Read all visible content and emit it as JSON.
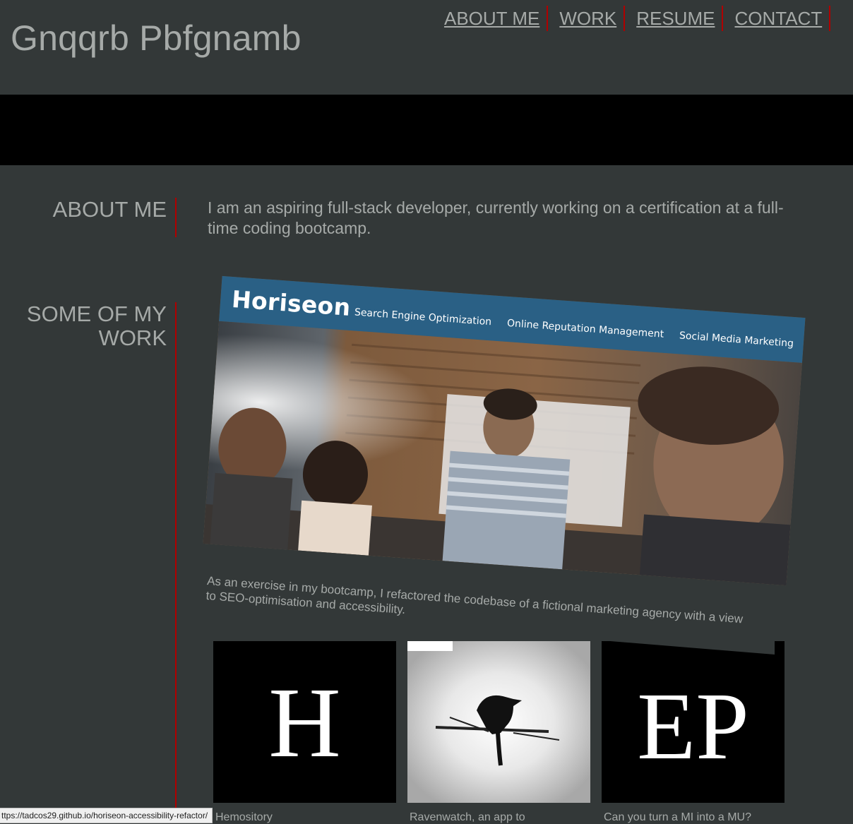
{
  "header": {
    "site_title": "Gnqqrb Pbfgnamb",
    "nav": [
      "ABOUT ME",
      "WORK",
      "RESUME",
      "CONTACT"
    ]
  },
  "about": {
    "heading": "ABOUT ME",
    "text": "I am an aspiring full-stack developer, currently working on a certification at a full-time coding bootcamp."
  },
  "work": {
    "heading": "SOME OF MY WORK",
    "featured": {
      "brand": "Horiseon",
      "links": [
        "Search Engine Optimization",
        "Online Reputation Management",
        "Social Media Marketing"
      ],
      "caption": "As an exercise in my bootcamp, I refactored the codebase of a fictional marketing agency with a view to SEO-optimisation and accessibility."
    },
    "projects": [
      {
        "thumb_letters": "H",
        "title": "Hemository"
      },
      {
        "thumb_icon": "raven-icon",
        "title": "Ravenwatch, an app to"
      },
      {
        "thumb_letters": "EP",
        "title": "Can you turn a MI into a MU?"
      }
    ]
  },
  "status_bar": {
    "url": "ttps://tadcos29.github.io/horiseon-accessibility-refactor/"
  },
  "colors": {
    "background": "#333838",
    "accent_red": "#b00000",
    "text_gray": "#a6aaa8",
    "horiseon_blue": "#2a6085"
  }
}
